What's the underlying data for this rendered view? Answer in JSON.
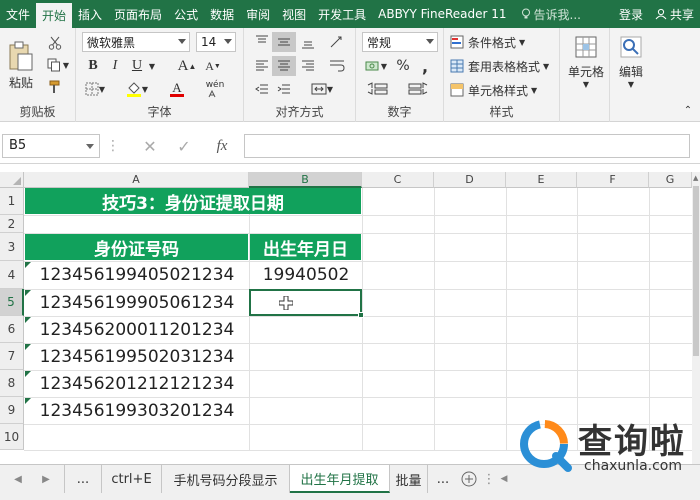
{
  "menu": {
    "tabs": [
      "文件",
      "开始",
      "插入",
      "页面布局",
      "公式",
      "数据",
      "审阅",
      "视图",
      "开发工具",
      "ABBYY FineReader 11"
    ],
    "active_index": 1,
    "tell": "告诉我...",
    "login": "登录",
    "share": "共享"
  },
  "ribbon": {
    "clipboard": {
      "paste": "粘贴",
      "label": "剪贴板"
    },
    "font": {
      "name": "微软雅黑",
      "size": "14",
      "bold": "B",
      "italic": "I",
      "underline": "U",
      "grow": "A",
      "shrink": "A",
      "color_a": "A",
      "wen": "wén",
      "label": "字体"
    },
    "align": {
      "label": "对齐方式"
    },
    "number": {
      "format": "常规",
      "pct": "%",
      "comma": ",",
      "label": "数字"
    },
    "styles": {
      "cond": "条件格式",
      "table": "套用表格格式",
      "cell": "单元格样式",
      "label": "样式"
    },
    "cells": {
      "label": "单元格"
    },
    "edit": {
      "label": "编辑"
    }
  },
  "formula_bar": {
    "name_box": "B5",
    "fx": "fx",
    "value": ""
  },
  "columns": [
    "A",
    "B",
    "C",
    "D",
    "E",
    "F",
    "G"
  ],
  "rows": [
    "1",
    "2",
    "3",
    "4",
    "5",
    "6",
    "7",
    "8",
    "9",
    "10"
  ],
  "sheet": {
    "title": "技巧3：身份证提取日期",
    "header_id": "身份证号码",
    "header_birth": "出生年月日",
    "ids": [
      "123456199405021234",
      "123456199905061234",
      "123456200011201234",
      "123456199502031234",
      "123456201212121234",
      "123456199303201234"
    ],
    "birth": [
      "19940502",
      "",
      "",
      "",
      "",
      ""
    ]
  },
  "sheet_tabs": [
    "...",
    "ctrl+E",
    "手机号码分段显示",
    "出生年月提取",
    "批量",
    "..."
  ],
  "active_sheet_index": 3,
  "watermark": {
    "big": "查询啦",
    "small": "chaxunla.com"
  },
  "colors": {
    "accent": "#217346",
    "header_green": "#11a15c"
  }
}
